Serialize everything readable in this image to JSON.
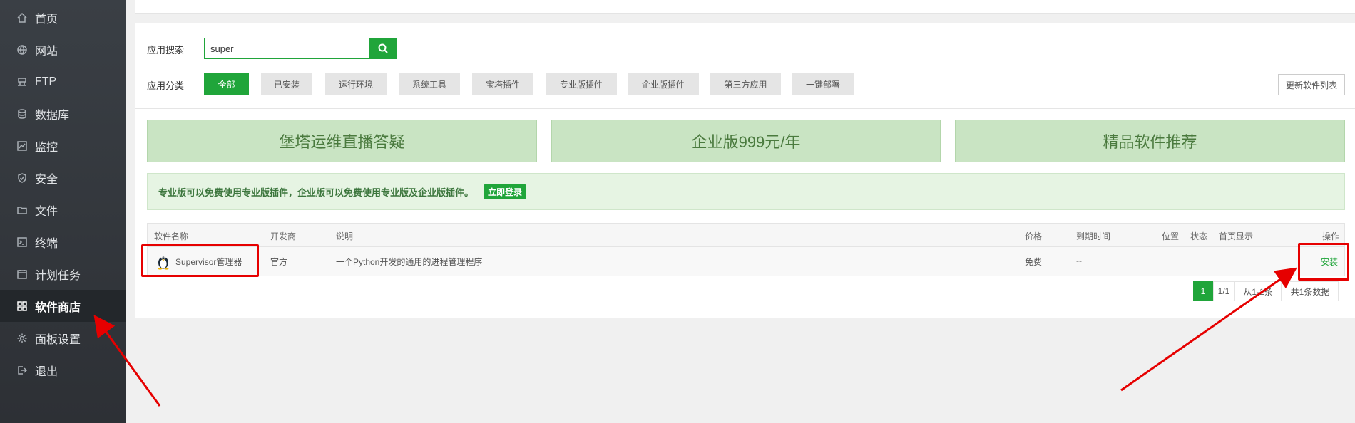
{
  "sidebar": {
    "items": [
      {
        "label": "首页",
        "icon": "home-icon"
      },
      {
        "label": "网站",
        "icon": "globe-icon"
      },
      {
        "label": "FTP",
        "icon": "ftp-icon"
      },
      {
        "label": "数据库",
        "icon": "database-icon"
      },
      {
        "label": "监控",
        "icon": "monitor-icon"
      },
      {
        "label": "安全",
        "icon": "shield-icon"
      },
      {
        "label": "文件",
        "icon": "folder-icon"
      },
      {
        "label": "终端",
        "icon": "terminal-icon"
      },
      {
        "label": "计划任务",
        "icon": "calendar-icon"
      },
      {
        "label": "软件商店",
        "icon": "grid-icon",
        "active": true
      },
      {
        "label": "面板设置",
        "icon": "gear-icon"
      },
      {
        "label": "退出",
        "icon": "logout-icon"
      }
    ]
  },
  "search": {
    "label": "应用搜索",
    "value": "super"
  },
  "category": {
    "label": "应用分类",
    "items": [
      "全部",
      "已安装",
      "运行环境",
      "系统工具",
      "宝塔插件",
      "专业版插件",
      "企业版插件",
      "第三方应用",
      "一键部署"
    ],
    "active_index": 0,
    "update_label": "更新软件列表"
  },
  "banners": [
    "堡塔运维直播答疑",
    "企业版999元/年",
    "精品软件推荐"
  ],
  "notice": {
    "text": "专业版可以免费使用专业版插件，企业版可以免费使用专业版及企业版插件。",
    "button": "立即登录"
  },
  "table": {
    "headers": [
      "软件名称",
      "开发商",
      "说明",
      "价格",
      "到期时间",
      "位置",
      "状态",
      "首页显示",
      "操作"
    ],
    "rows": [
      {
        "name": "Supervisor管理器",
        "developer": "官方",
        "description": "一个Python开发的通用的进程管理程序",
        "price": "免费",
        "expire": "--",
        "action": "安装"
      }
    ]
  },
  "pagination": {
    "current": "1",
    "pages": "1/1",
    "range": "从1-1条",
    "total": "共1条数据"
  },
  "colors": {
    "accent": "#20a53a",
    "annotation": "#e60000"
  }
}
